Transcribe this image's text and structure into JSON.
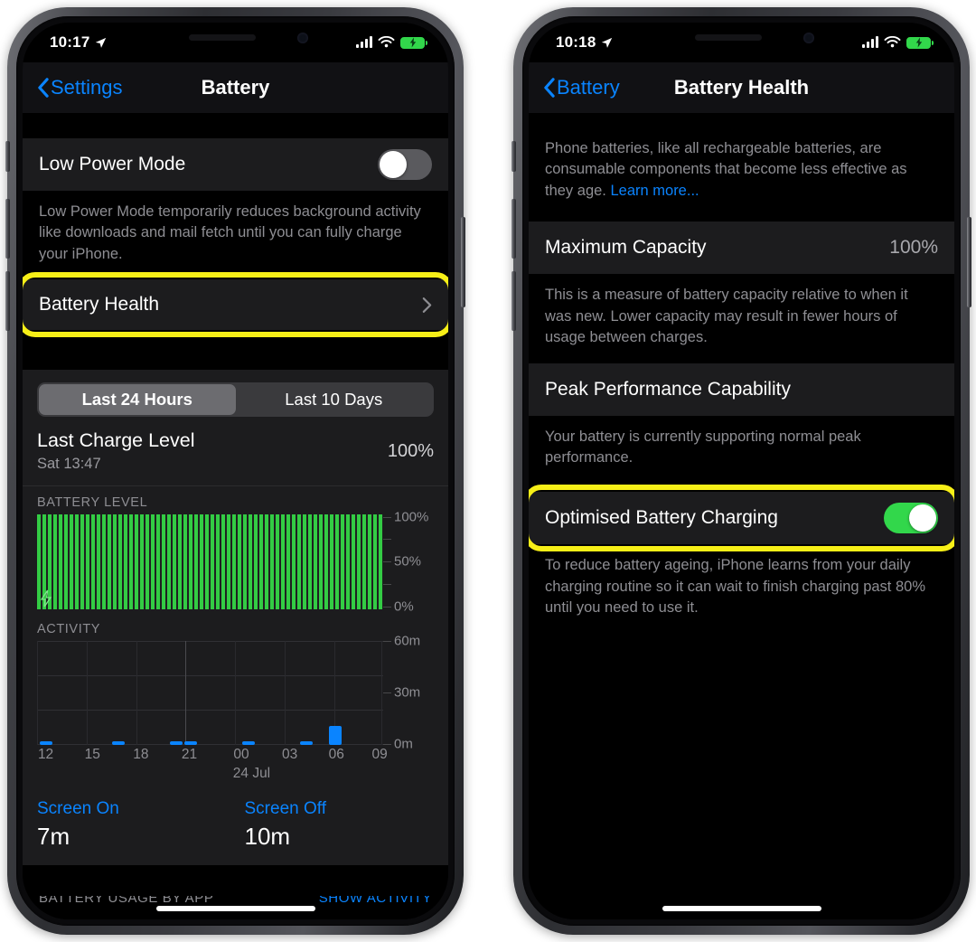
{
  "left_phone": {
    "status_bar": {
      "time": "10:17",
      "location_icon": "location-arrow-icon",
      "signal_icon": "cellular-signal-icon",
      "wifi_icon": "wifi-icon",
      "battery_icon": "battery-charging-icon"
    },
    "nav": {
      "back_label": "Settings",
      "title": "Battery",
      "back_icon": "chevron-left-icon"
    },
    "low_power": {
      "label": "Low Power Mode",
      "toggle_state": "off",
      "footnote": "Low Power Mode temporarily reduces background activity like downloads and mail fetch until you can fully charge your iPhone."
    },
    "battery_health_row": {
      "label": "Battery Health",
      "chevron_icon": "chevron-right-icon",
      "highlighted": true,
      "highlight_color": "#f7ef17"
    },
    "segmented": {
      "options": [
        "Last 24 Hours",
        "Last 10 Days"
      ],
      "selected": "Last 24 Hours"
    },
    "last_charge": {
      "title": "Last Charge Level",
      "subtitle": "Sat 13:47",
      "value": "100%"
    },
    "battery_level_chart_label": "BATTERY LEVEL",
    "activity_chart_label": "ACTIVITY",
    "screen_on": {
      "label": "Screen On",
      "value": "7m"
    },
    "screen_off": {
      "label": "Screen Off",
      "value": "10m"
    },
    "cut_footer": {
      "left": "BATTERY USAGE BY APP",
      "right": "SHOW ACTIVITY"
    }
  },
  "right_phone": {
    "status_bar": {
      "time": "10:18",
      "location_icon": "location-arrow-icon",
      "signal_icon": "cellular-signal-icon",
      "wifi_icon": "wifi-icon",
      "battery_icon": "battery-charging-icon"
    },
    "nav": {
      "back_label": "Battery",
      "title": "Battery Health",
      "back_icon": "chevron-left-icon"
    },
    "intro": {
      "text": "Phone batteries, like all rechargeable batteries, are consumable components that become less effective as they age. ",
      "link": "Learn more..."
    },
    "maximum_capacity": {
      "label": "Maximum Capacity",
      "value": "100%",
      "footnote": "This is a measure of battery capacity relative to when it was new. Lower capacity may result in fewer hours of usage between charges."
    },
    "peak_performance": {
      "label": "Peak Performance Capability",
      "footnote": "Your battery is currently supporting normal peak performance."
    },
    "optimised_charging": {
      "label": "Optimised Battery Charging",
      "toggle_state": "on",
      "highlighted": true,
      "highlight_color": "#f7ef17",
      "toggle_color": "#32d74b",
      "footnote": "To reduce battery ageing, iPhone learns from your daily charging routine so it can wait to finish charging past 80% until you need to use it."
    }
  },
  "chart_data": [
    {
      "type": "bar",
      "title": "BATTERY LEVEL",
      "x": [
        "12",
        "15",
        "18",
        "21",
        "00",
        "03",
        "06",
        "09"
      ],
      "values": [
        100,
        100,
        100,
        100,
        100,
        100,
        100,
        100,
        100,
        100,
        100,
        100,
        100,
        100,
        100,
        100,
        100,
        100,
        100,
        100,
        100,
        100,
        100,
        100
      ],
      "ylabel": "",
      "ytick_labels": [
        "100%",
        "50%",
        "0%"
      ],
      "ylim": [
        0,
        100
      ],
      "bar_color": "#33cc44",
      "grid": false,
      "annotation": "charging-bolt-icon"
    },
    {
      "type": "bar",
      "title": "ACTIVITY",
      "categories": [
        "12",
        "13",
        "14",
        "15",
        "16",
        "17",
        "18",
        "19",
        "20",
        "21",
        "22",
        "23",
        "00",
        "01",
        "02",
        "03",
        "04",
        "05",
        "06",
        "07",
        "08",
        "09",
        "10",
        "11"
      ],
      "values": [
        2,
        0,
        0,
        0,
        0,
        2,
        0,
        0,
        0,
        2,
        2,
        0,
        0,
        0,
        2,
        0,
        0,
        0,
        2,
        0,
        11,
        0,
        0,
        0
      ],
      "xlabel": "24 Jul",
      "ylabel": "",
      "ytick_labels": [
        "60m",
        "30m",
        "0m"
      ],
      "xtick_labels": [
        "12",
        "15",
        "18",
        "21",
        "00",
        "03",
        "06",
        "09"
      ],
      "ylim": [
        0,
        60
      ],
      "bar_color": "#0a84ff",
      "grid": true
    }
  ]
}
